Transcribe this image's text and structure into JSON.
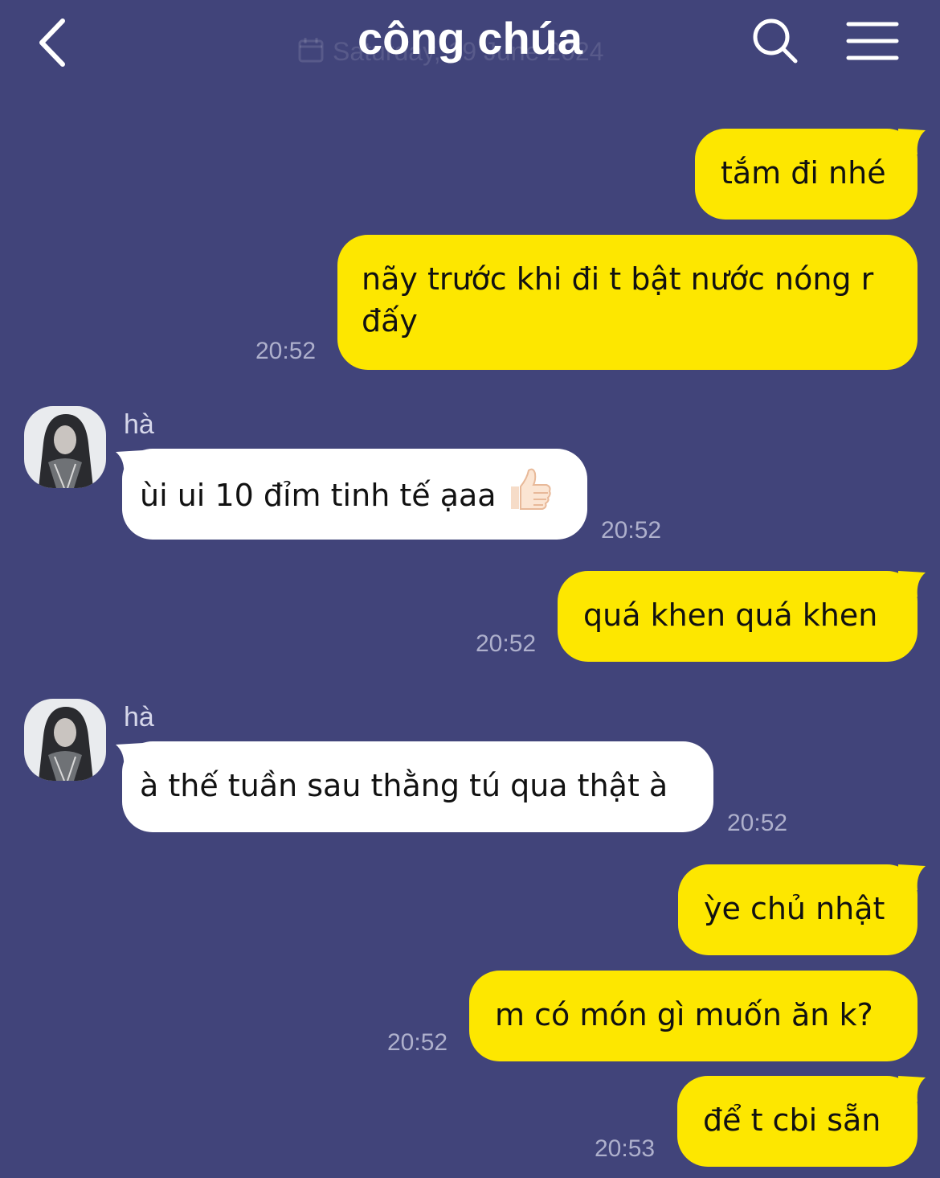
{
  "header": {
    "title": "công chúa",
    "ghost_date": "Saturday, 19 June 2024"
  },
  "contact": {
    "name": "hà"
  },
  "messages": [
    {
      "dir": "out",
      "text": "tắm đi nhé"
    },
    {
      "dir": "out",
      "text": "nãy trước khi đi t bật nước nóng r đấy",
      "time": "20:52"
    },
    {
      "dir": "in",
      "text": "ùi ui 10 đỉm tinh tế ạaa",
      "time": "20:52"
    },
    {
      "dir": "out",
      "text": "quá khen quá khen",
      "time": "20:52"
    },
    {
      "dir": "in",
      "text": "à thế tuần sau thằng tú qua thật à",
      "time": "20:52"
    },
    {
      "dir": "out",
      "text": "ỳe chủ nhật"
    },
    {
      "dir": "out",
      "text": "m có món gì muốn ăn k?",
      "time": "20:52"
    },
    {
      "dir": "out",
      "text": "để t cbi sẵn",
      "time": "20:53"
    }
  ],
  "colors": {
    "background": "#41447a",
    "outgoing_bubble": "#fde700",
    "incoming_bubble": "#ffffff",
    "timestamp": "#aeb0cc"
  },
  "icons": {
    "back": "chevron-left-icon",
    "search": "search-icon",
    "menu": "hamburger-menu-icon",
    "reaction": "thumbs-up-emoji"
  }
}
